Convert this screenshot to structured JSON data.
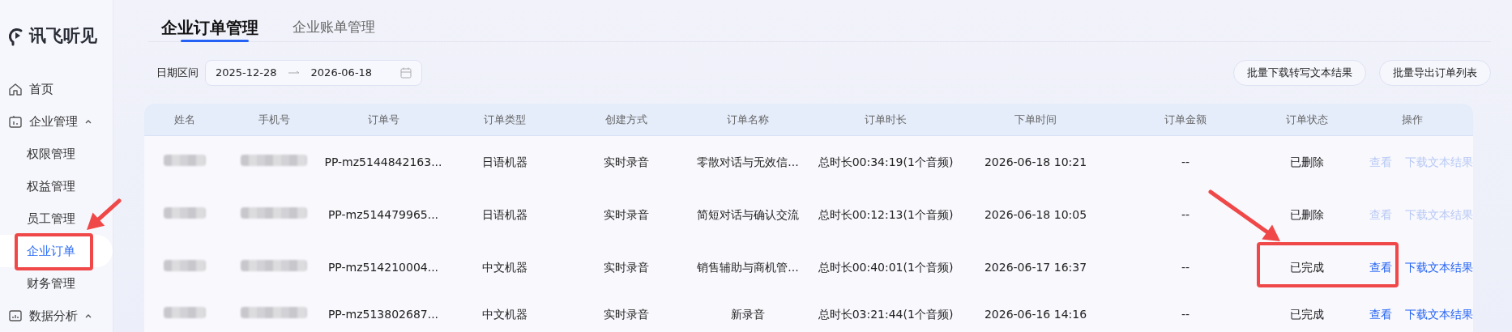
{
  "brand": {
    "name": "讯飞听见"
  },
  "sidebar": {
    "items": [
      {
        "label": "首页",
        "kind": "home",
        "selected": false
      },
      {
        "label": "企业管理",
        "kind": "group",
        "expanded": true,
        "children": [
          {
            "label": "权限管理",
            "selected": false
          },
          {
            "label": "权益管理",
            "selected": false
          },
          {
            "label": "员工管理",
            "selected": false
          },
          {
            "label": "企业订单",
            "selected": true
          },
          {
            "label": "财务管理",
            "selected": false
          }
        ]
      },
      {
        "label": "数据分析",
        "kind": "chart",
        "expanded": true
      }
    ]
  },
  "tabs": [
    {
      "label": "企业订单管理",
      "selected": true
    },
    {
      "label": "企业账单管理",
      "selected": false
    }
  ],
  "filter": {
    "label": "日期区间",
    "start": "2025-12-28",
    "end": "2026-06-18"
  },
  "buttons": [
    "批量下载转写文本结果",
    "批量导出订单列表"
  ],
  "table": {
    "columns": [
      "姓名",
      "手机号",
      "订单号",
      "订单类型",
      "创建方式",
      "订单名称",
      "订单时长",
      "下单时间",
      "订单金额",
      "订单状态",
      "操作"
    ],
    "rows": [
      {
        "redacted": true,
        "order_no": "PP-mz5144842163...",
        "type": "日语机器",
        "method": "实时录音",
        "name": "零散对话与无效信...",
        "duration": "总时长00:34:19(1个音频)",
        "time": "2026-06-18 10:21",
        "amount": "--",
        "status": "已删除",
        "actions": [
          {
            "label": "查看",
            "disabled": true
          },
          {
            "label": "下载文本结果",
            "disabled": true
          }
        ]
      },
      {
        "redacted": true,
        "order_no": "PP-mz514479965...",
        "type": "日语机器",
        "method": "实时录音",
        "name": "简短对话与确认交流",
        "duration": "总时长00:12:13(1个音频)",
        "time": "2026-06-18 10:05",
        "amount": "--",
        "status": "已删除",
        "actions": [
          {
            "label": "查看",
            "disabled": true
          },
          {
            "label": "下载文本结果",
            "disabled": true
          }
        ]
      },
      {
        "redacted": true,
        "order_no": "PP-mz514210004...",
        "type": "中文机器",
        "method": "实时录音",
        "name": "销售辅助与商机管...",
        "duration": "总时长00:40:01(1个音频)",
        "time": "2026-06-17 16:37",
        "amount": "--",
        "status": "已完成",
        "actions": [
          {
            "label": "查看",
            "disabled": false
          },
          {
            "label": "下载文本结果",
            "disabled": false
          }
        ]
      },
      {
        "redacted": true,
        "order_no": "PP-mz513802687...",
        "type": "中文机器",
        "method": "实时录音",
        "name": "新录音",
        "duration": "总时长03:21:44(1个音频)",
        "time": "2026-06-16 14:16",
        "amount": "--",
        "status": "已完成",
        "actions": [
          {
            "label": "查看",
            "disabled": false
          },
          {
            "label": "下载文本结果",
            "disabled": false
          }
        ]
      }
    ]
  },
  "annotations": [
    {
      "kind": "box"
    },
    {
      "kind": "arrow"
    },
    {
      "kind": "box"
    },
    {
      "kind": "arrow"
    }
  ]
}
